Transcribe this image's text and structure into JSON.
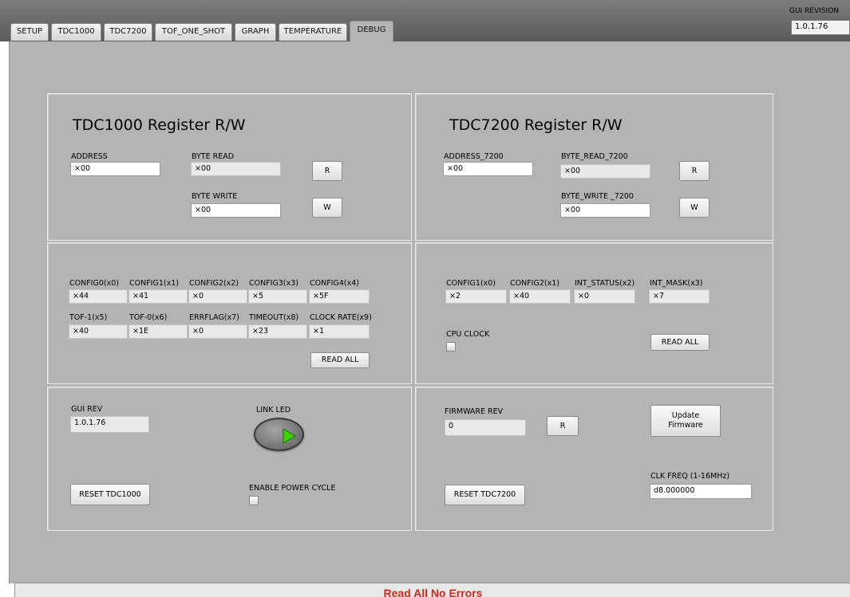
{
  "tabs": [
    {
      "label": "SETUP"
    },
    {
      "label": "TDC1000"
    },
    {
      "label": "TDC7200"
    },
    {
      "label": "TOF_ONE_SHOT"
    },
    {
      "label": "GRAPH"
    },
    {
      "label": "TEMPERATURE"
    },
    {
      "label": "DEBUG"
    }
  ],
  "active_tab": "DEBUG",
  "gui_revision": {
    "label": "GUI REVISION",
    "value": "1.0.1.76"
  },
  "tdc1000_rw": {
    "title": "TDC1000 Register R/W",
    "address_label": "ADDRESS",
    "address_value": "×00",
    "byte_read_label": "BYTE READ",
    "byte_read_value": "×00",
    "byte_write_label": "BYTE WRITE",
    "byte_write_value": "×00",
    "read_button": "R",
    "write_button": "W"
  },
  "tdc7200_rw": {
    "title": "TDC7200 Register R/W",
    "address_label": "ADDRESS_7200",
    "address_value": "×00",
    "byte_read_label": "BYTE_READ_7200",
    "byte_read_value": "×00",
    "byte_write_label": "BYTE_WRITE _7200",
    "byte_write_value": "×00",
    "read_button": "R",
    "write_button": "W"
  },
  "tdc1000_regs": {
    "regs": [
      {
        "label": "CONFIG0(x0)",
        "value": "×44"
      },
      {
        "label": "CONFIG1(x1)",
        "value": "×41"
      },
      {
        "label": "CONFIG2(x2)",
        "value": "×0"
      },
      {
        "label": "CONFIG3(x3)",
        "value": "×5"
      },
      {
        "label": "CONFIG4(x4)",
        "value": "×5F"
      },
      {
        "label": "TOF-1(x5)",
        "value": "×40"
      },
      {
        "label": "TOF-0(x6)",
        "value": "×1E"
      },
      {
        "label": "ERRFLAG(x7)",
        "value": "×0"
      },
      {
        "label": "TIMEOUT(x8)",
        "value": "×23"
      },
      {
        "label": "CLOCK RATE(x9)",
        "value": "×1"
      }
    ],
    "read_all_button": "READ ALL"
  },
  "tdc7200_regs": {
    "regs": [
      {
        "label": "CONFIG1(x0)",
        "value": "×2"
      },
      {
        "label": "CONFIG2(x1)",
        "value": "×40"
      },
      {
        "label": "INT_STATUS(x2)",
        "value": "×0"
      },
      {
        "label": "INT_MASK(x3)",
        "value": "×7"
      }
    ],
    "cpu_clock_label": "CPU CLOCK",
    "read_all_button": "READ ALL"
  },
  "tdc1000_misc": {
    "gui_rev_label": "GUI REV",
    "gui_rev_value": "1.0.1.76",
    "link_led_label": "LINK LED",
    "reset_button": "RESET TDC1000",
    "enable_power_cycle_label": "ENABLE POWER CYCLE"
  },
  "tdc7200_misc": {
    "firmware_rev_label": "FIRMWARE REV",
    "firmware_rev_value": "0",
    "read_button": "R",
    "update_firmware_line1": "Update",
    "update_firmware_line2": "Firmware",
    "clk_freq_label": "CLK FREQ (1-16MHz)",
    "clk_freq_value": "d8.000000",
    "reset_button": "RESET TDC7200"
  },
  "status": {
    "text": "Read All No Errors"
  },
  "colors": {
    "status_text": "#d12a1a",
    "panel": "#b4b4b4",
    "led_arrow": "#3fd400"
  }
}
